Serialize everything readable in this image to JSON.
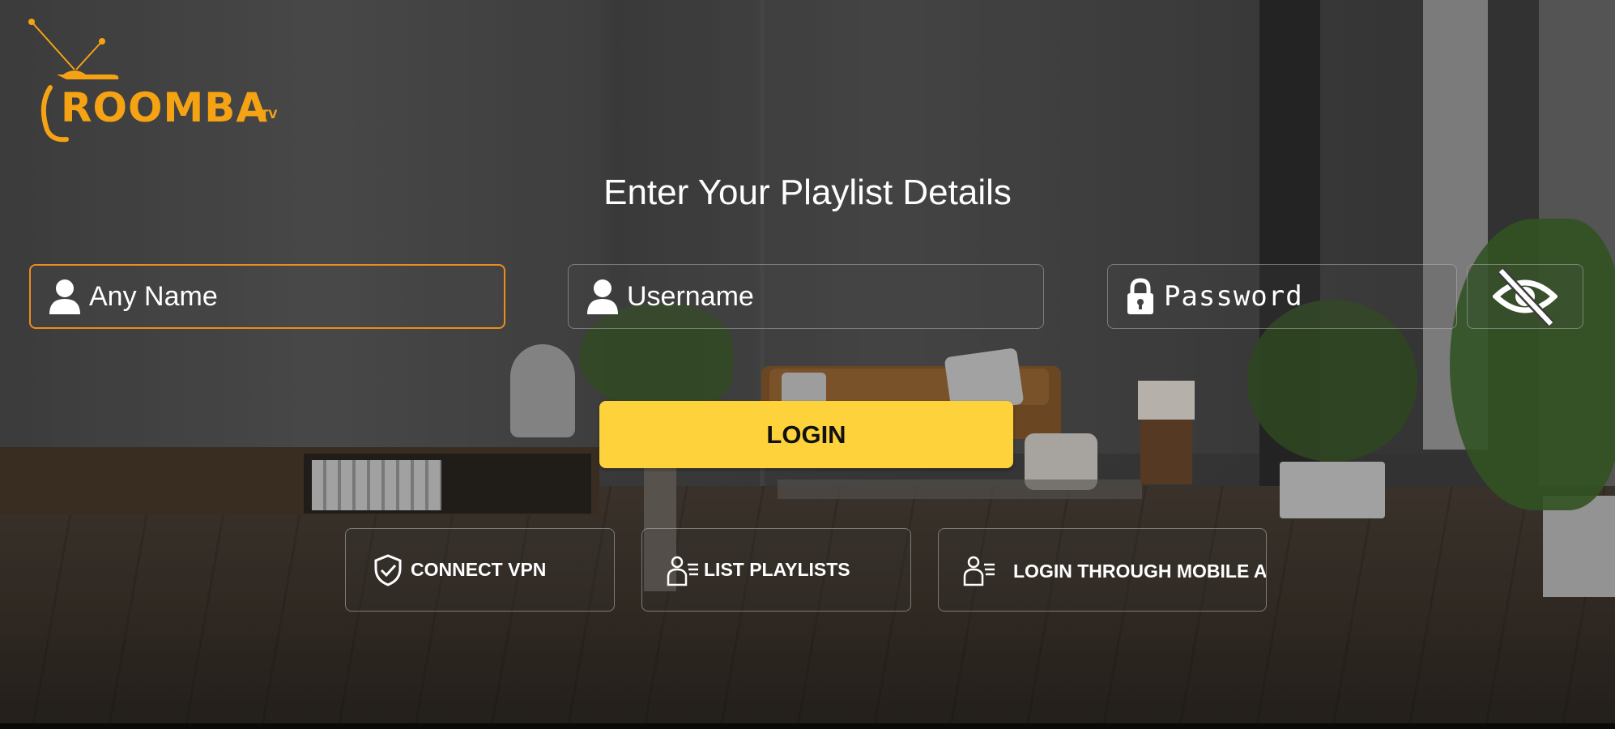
{
  "brand": {
    "name": "ROOMBA",
    "superscript": "TV",
    "color": "#f6a313"
  },
  "title": "Enter Your Playlist Details",
  "form": {
    "name_field": {
      "placeholder": "Any Name",
      "value": "",
      "icon": "user-icon",
      "focused": true
    },
    "username_field": {
      "placeholder": "Username",
      "value": "",
      "icon": "user-icon"
    },
    "password_field": {
      "placeholder": "Password",
      "value": "",
      "icon": "lock-icon"
    },
    "visibility_toggle": {
      "icon": "eye-slash-icon"
    },
    "login_label": "LOGIN"
  },
  "actions": [
    {
      "label": "CONNECT VPN",
      "icon": "shield-check-icon"
    },
    {
      "label": "LIST PLAYLISTS",
      "icon": "user-list-icon"
    },
    {
      "label": "LOGIN THROUGH MOBILE APP",
      "icon": "user-list-icon"
    }
  ],
  "colors": {
    "accent": "#fdd23a",
    "focus_border": "#ec8d1c",
    "text": "#ffffff"
  }
}
